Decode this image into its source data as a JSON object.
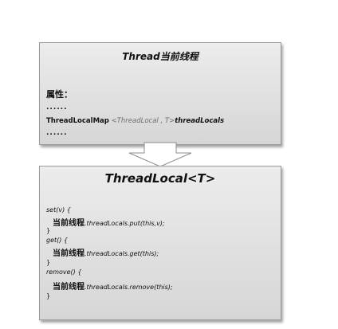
{
  "thread_box": {
    "title": "Thread当前线程",
    "attr_label": "属性：",
    "dots_top": "......",
    "field": {
      "type": "ThreadLocalMap",
      "generic": "<ThreadLocal , T>",
      "name": "threadLocals"
    },
    "dots_bottom": "......"
  },
  "threadlocal_box": {
    "title": "ThreadLocal<T>",
    "methods": [
      {
        "signature": "set(v) {",
        "cn": "当前线程",
        "body": ".threadLocals.put(this,v);",
        "close": "}"
      },
      {
        "signature": "get() {",
        "cn": "当前线程",
        "body": ".threadLocals.get(this);",
        "close": "}"
      },
      {
        "signature": "remove() {",
        "cn": "当前线程",
        "body": ".threadLocals.remove(this);",
        "close": "}"
      }
    ]
  }
}
